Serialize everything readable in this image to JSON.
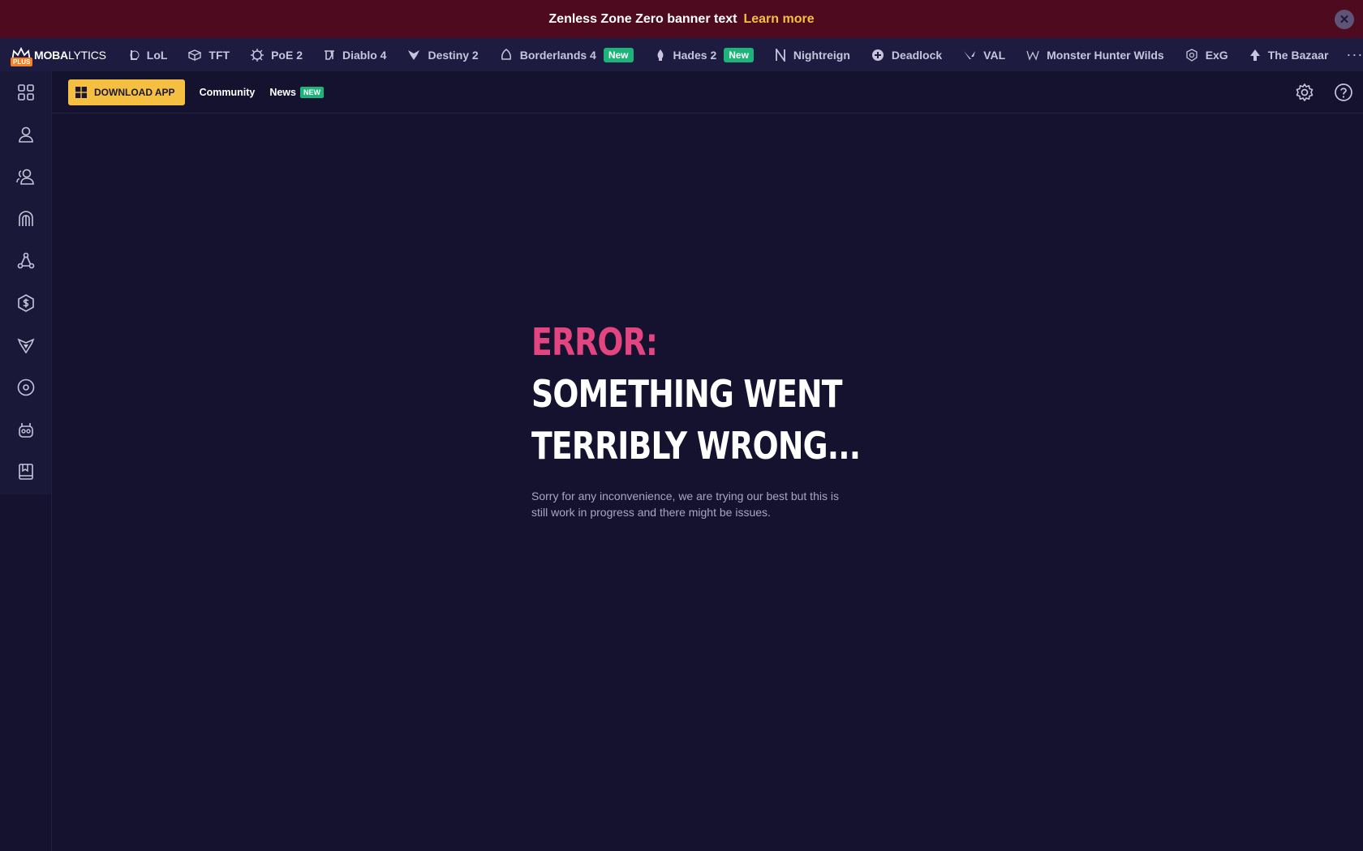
{
  "banner": {
    "text": "Zenless Zone Zero banner text",
    "link": "Learn more",
    "close_icon": "close-icon"
  },
  "logo": {
    "bold": "MOBA",
    "light": "LYTICS",
    "plus": "PLUS"
  },
  "games": [
    {
      "label": "LoL",
      "icon": "lol-icon"
    },
    {
      "label": "TFT",
      "icon": "tft-icon"
    },
    {
      "label": "PoE 2",
      "icon": "poe2-icon"
    },
    {
      "label": "Diablo 4",
      "icon": "diablo4-icon"
    },
    {
      "label": "Destiny 2",
      "icon": "destiny2-icon"
    },
    {
      "label": "Borderlands 4",
      "icon": "borderlands4-icon",
      "badge": "New"
    },
    {
      "label": "Hades 2",
      "icon": "hades2-icon",
      "badge": "New"
    },
    {
      "label": "Nightreign",
      "icon": "nightreign-icon"
    },
    {
      "label": "Deadlock",
      "icon": "deadlock-icon"
    },
    {
      "label": "VAL",
      "icon": "valorant-icon"
    },
    {
      "label": "Monster Hunter Wilds",
      "icon": "mhw-icon"
    },
    {
      "label": "ExG",
      "icon": "exg-icon"
    },
    {
      "label": "The Bazaar",
      "icon": "bazaar-icon"
    }
  ],
  "more_icon": "more-dots-icon",
  "sidebar_icons": [
    "grid-icon",
    "profile-icon",
    "users-icon",
    "champion-icon",
    "network-icon",
    "shield-dollar-icon",
    "crest-icon",
    "disc-icon",
    "robot-icon",
    "book-icon"
  ],
  "topbar": {
    "download": "DOWNLOAD APP",
    "community": "Community",
    "news": "News",
    "news_badge": "NEW"
  },
  "error": {
    "label": "ERROR:",
    "line1": "SOMETHING WENT",
    "line2": "TERRIBLY WRONG...",
    "description": "Sorry for any inconvenience, we are trying our best but this is still work in progress and there might be issues."
  },
  "colors": {
    "accent_pink": "#e2457f",
    "accent_yellow": "#f5c041",
    "badge_green": "#1db47a",
    "banner_bg": "#4e0a1f",
    "page_bg": "#15122f"
  }
}
